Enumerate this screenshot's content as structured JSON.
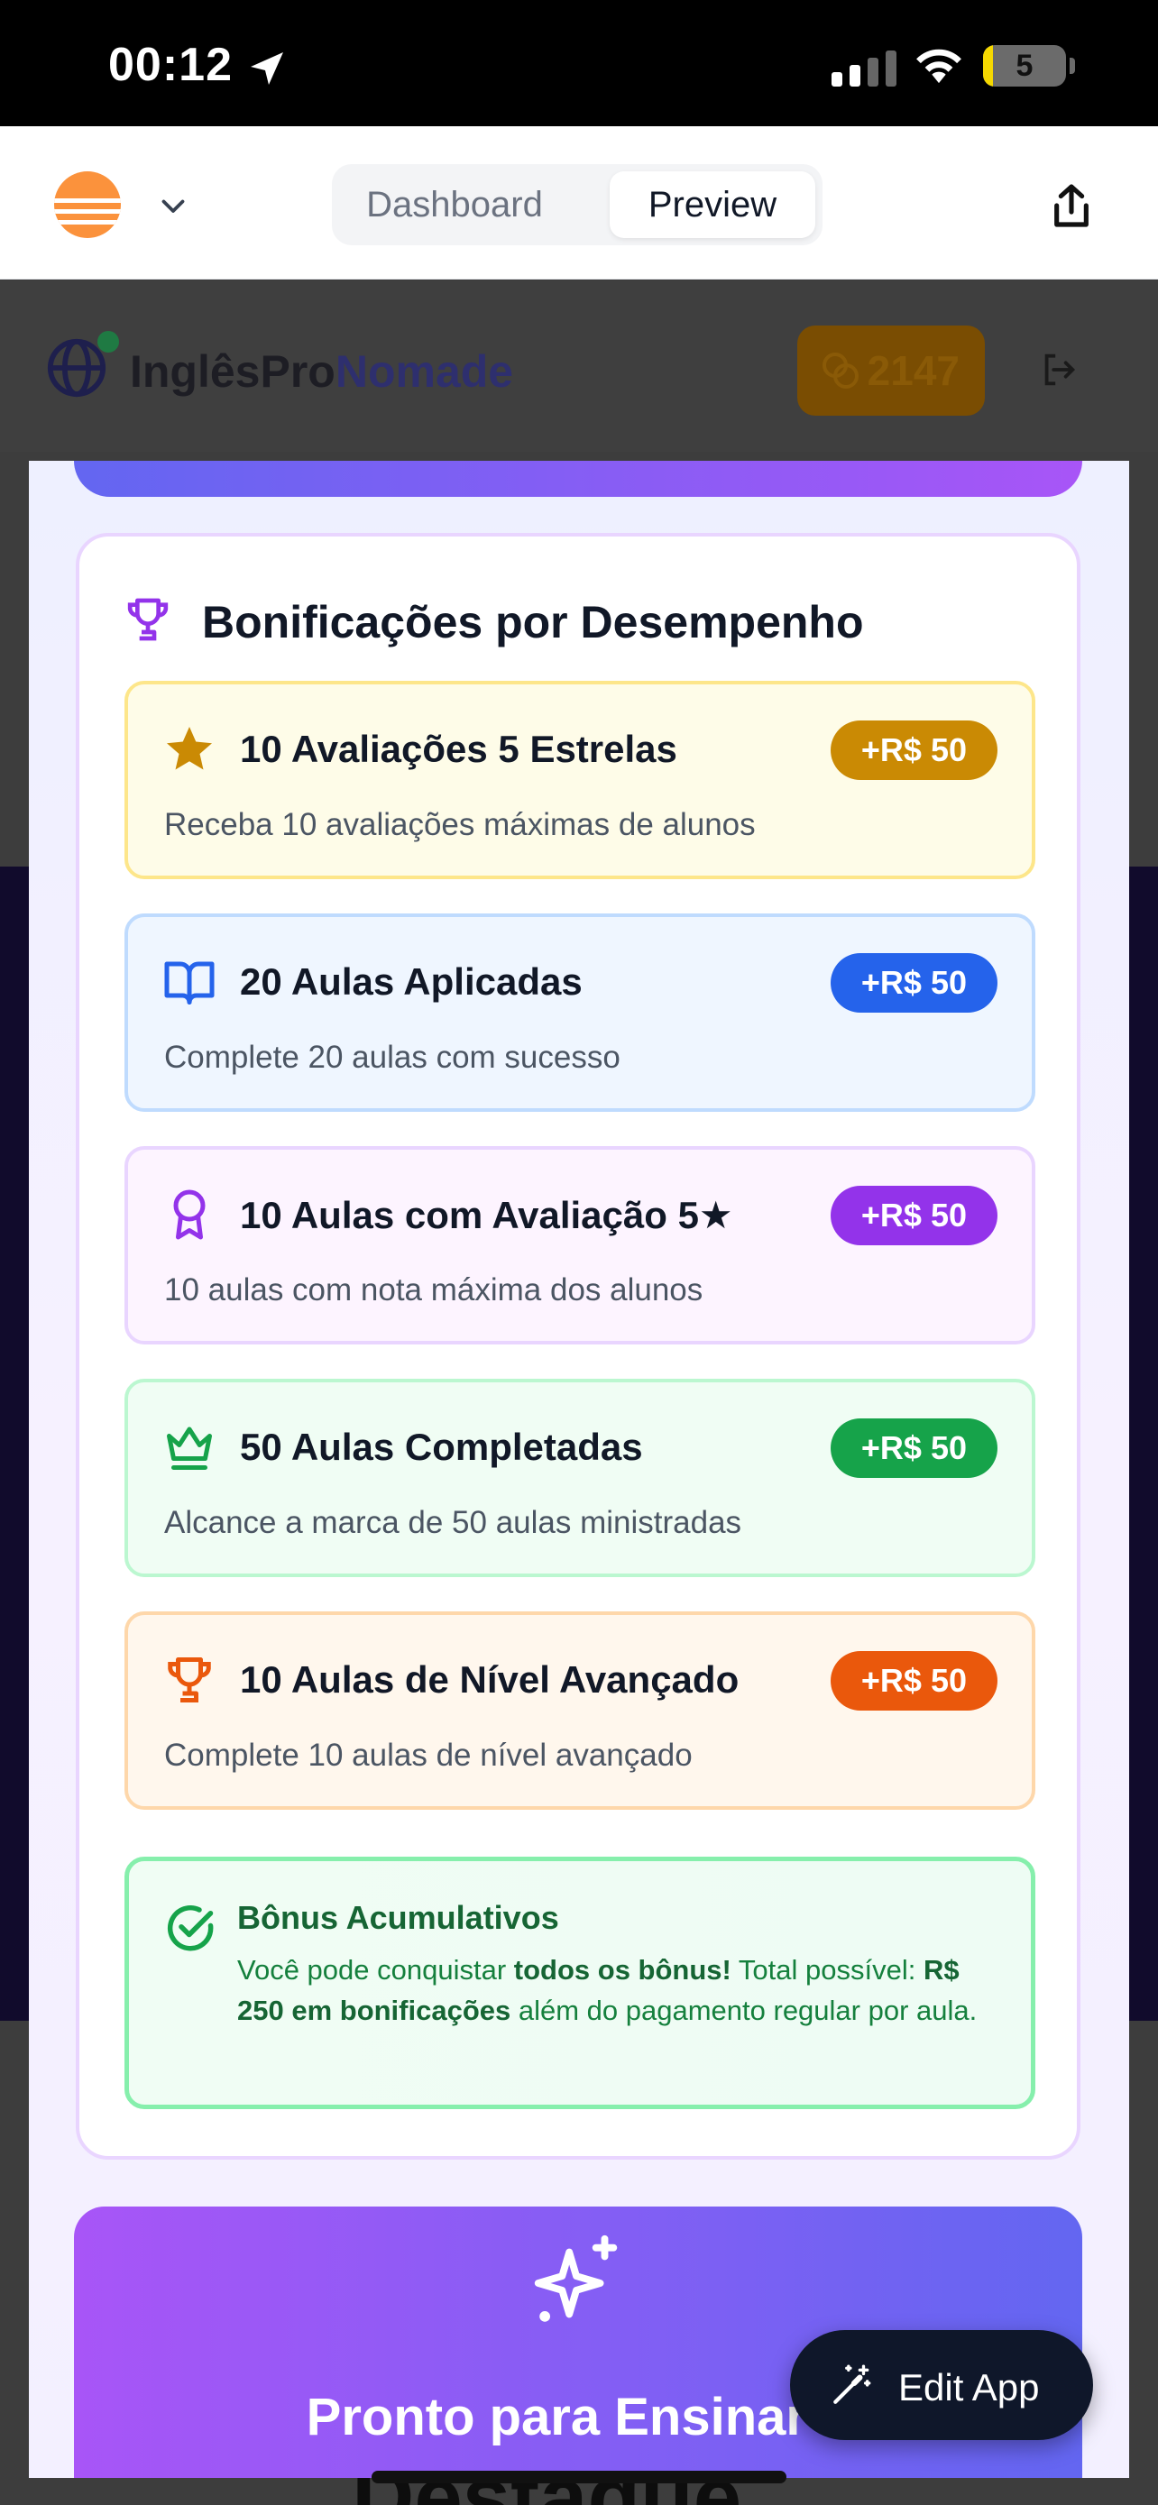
{
  "status_bar": {
    "time": "00:12",
    "battery": "5"
  },
  "nav": {
    "segments": [
      {
        "label": "Dashboard",
        "active": false
      },
      {
        "label": "Preview",
        "active": true
      }
    ]
  },
  "background_app": {
    "brand_part1": "InglêsPro",
    "brand_part2": "Nomade",
    "coins": "2147",
    "bottom_text": "Destaque"
  },
  "bonus": {
    "title": "Bonificações por Desempenho",
    "items": [
      {
        "icon": "star-icon",
        "title": "10 Avaliações 5 Estrelas",
        "badge": "+R$ 50",
        "desc": "Receba 10 avaliações máximas de alunos",
        "color": "#ca8a04"
      },
      {
        "icon": "book-open-icon",
        "title": "20 Aulas Aplicadas",
        "badge": "+R$ 50",
        "desc": "Complete 20 aulas com sucesso",
        "color": "#2563eb"
      },
      {
        "icon": "award-icon",
        "title": "10 Aulas com Avaliação 5★",
        "badge": "+R$ 50",
        "desc": "10 aulas com nota máxima dos alunos",
        "color": "#9333ea"
      },
      {
        "icon": "crown-icon",
        "title": "50 Aulas Completadas",
        "badge": "+R$ 50",
        "desc": "Alcance a marca de 50 aulas ministradas",
        "color": "#16a34a"
      },
      {
        "icon": "trophy-icon",
        "title": "10 Aulas de Nível Avançado",
        "badge": "+R$ 50",
        "desc": "Complete 10 aulas de nível avançado",
        "color": "#ea580c"
      }
    ],
    "cumulative": {
      "title": "Bônus Acumulativos",
      "text_1": "Você pode conquistar ",
      "text_2": "todos os bônus!",
      "text_3": " Total possível: ",
      "text_4": "R$ 250 em bonificações",
      "text_5": " além do pagamento regular por aula."
    }
  },
  "cta": {
    "title": "Pronto para Ensinar e"
  },
  "edit_app": {
    "label": "Edit App"
  }
}
